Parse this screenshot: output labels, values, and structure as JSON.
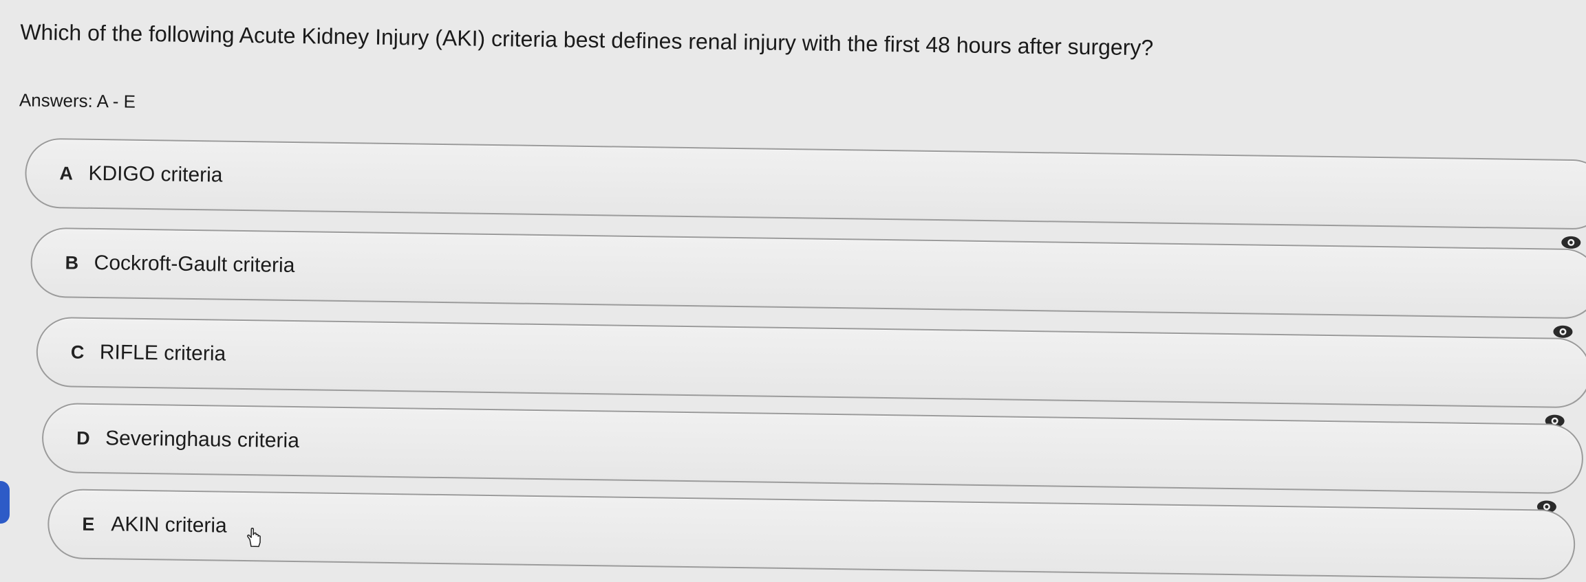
{
  "question": {
    "text": "Which of the following Acute Kidney Injury (AKI) criteria best defines renal injury with the first 48 hours after surgery?"
  },
  "answers_label": "Answers: A - E",
  "options": [
    {
      "letter": "A",
      "text": "KDIGO criteria",
      "icon": "eye-icon"
    },
    {
      "letter": "B",
      "text": "Cockroft-Gault criteria",
      "icon": "eye-icon"
    },
    {
      "letter": "C",
      "text": "RIFLE criteria",
      "icon": "eye-icon"
    },
    {
      "letter": "D",
      "text": "Severinghaus criteria",
      "icon": "eye-icon"
    },
    {
      "letter": "E",
      "text": "AKIN criteria"
    }
  ],
  "colors": {
    "background": "#e9e9e9",
    "option_border": "#9b9b9b",
    "option_fill": "#efefef",
    "text": "#1f1f1f",
    "side_accent": "#2d5bc7"
  }
}
